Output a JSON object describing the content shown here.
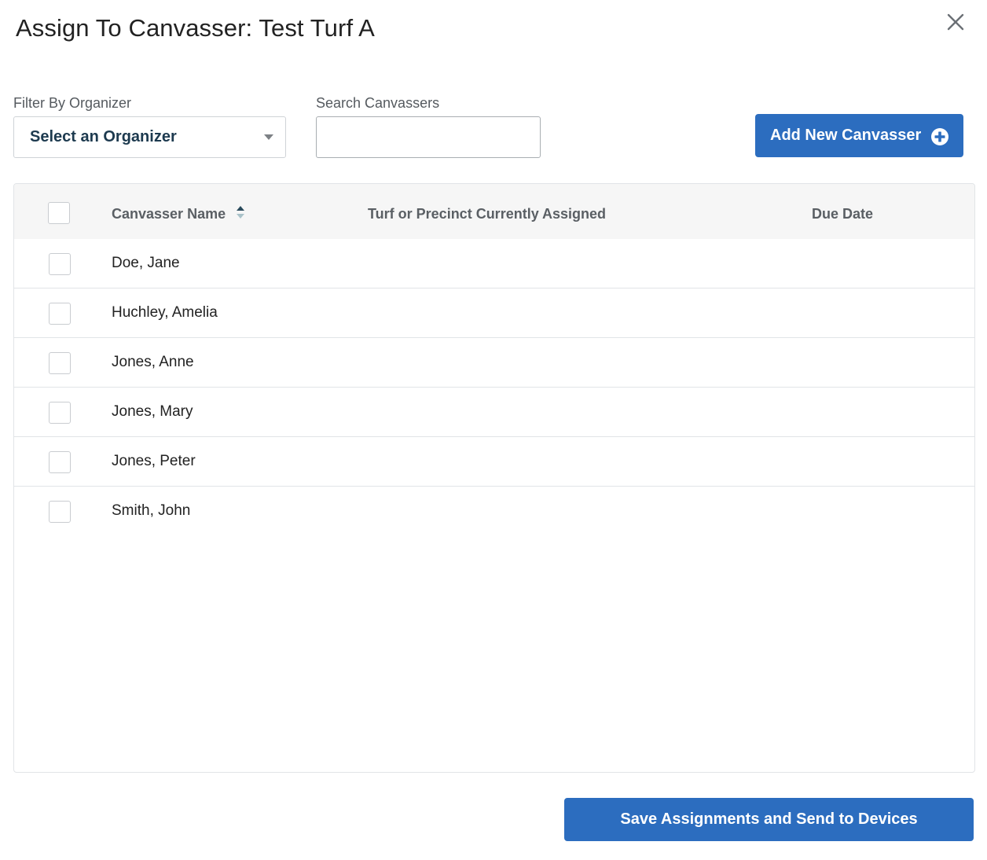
{
  "dialog": {
    "title": "Assign To Canvasser: Test Turf A",
    "close_icon": "close-icon"
  },
  "filters": {
    "organizer_label": "Filter By Organizer",
    "organizer_selected": "Select an Organizer",
    "search_label": "Search Canvassers",
    "search_value": "",
    "search_placeholder": ""
  },
  "toolbar": {
    "add_label": "Add New Canvasser",
    "add_icon": "plus-circle-icon"
  },
  "table": {
    "columns": [
      "Canvasser Name",
      "Turf or Precinct Currently Assigned",
      "Due Date"
    ],
    "sort_icon": "sort-icon",
    "rows": [
      {
        "name": "Doe, Jane",
        "turf": "",
        "due": ""
      },
      {
        "name": "Huchley, Amelia",
        "turf": "",
        "due": ""
      },
      {
        "name": "Jones, Anne",
        "turf": "",
        "due": ""
      },
      {
        "name": "Jones, Mary",
        "turf": "",
        "due": ""
      },
      {
        "name": "Jones, Peter",
        "turf": "",
        "due": ""
      },
      {
        "name": "Smith, John",
        "turf": "",
        "due": ""
      }
    ]
  },
  "footer": {
    "save_label": "Save Assignments and Send to Devices"
  },
  "colors": {
    "primary": "#2c6dbf",
    "header_bg": "#f6f6f6",
    "border": "#e1e4e7"
  }
}
